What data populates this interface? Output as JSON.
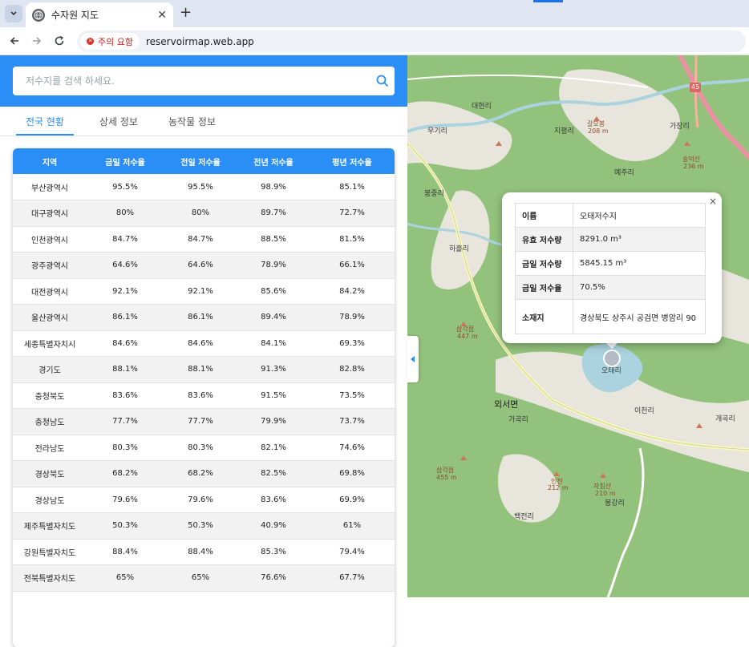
{
  "browser": {
    "tab_title": "수자원 지도",
    "new_tab_label": "+",
    "security_label": "주의 요함",
    "url": "reservoirmap.web.app"
  },
  "search": {
    "placeholder": "저수지를 검색 하세요."
  },
  "tabs": [
    {
      "label": "전국 현황"
    },
    {
      "label": "상세 정보"
    },
    {
      "label": "농작물 정보"
    }
  ],
  "table": {
    "headers": [
      "지역",
      "금일 저수율",
      "전일 저수율",
      "전년 저수율",
      "평년 저수율"
    ],
    "rows": [
      [
        "부산광역시",
        "95.5%",
        "95.5%",
        "98.9%",
        "85.1%"
      ],
      [
        "대구광역시",
        "80%",
        "80%",
        "89.7%",
        "72.7%"
      ],
      [
        "인천광역시",
        "84.7%",
        "84.7%",
        "88.5%",
        "81.5%"
      ],
      [
        "광주광역시",
        "64.6%",
        "64.6%",
        "78.9%",
        "66.1%"
      ],
      [
        "대전광역시",
        "92.1%",
        "92.1%",
        "85.6%",
        "84.2%"
      ],
      [
        "울산광역시",
        "86.1%",
        "86.1%",
        "89.4%",
        "78.9%"
      ],
      [
        "세종특별자치시",
        "84.6%",
        "84.6%",
        "84.1%",
        "69.3%"
      ],
      [
        "경기도",
        "88.1%",
        "88.1%",
        "91.3%",
        "82.8%"
      ],
      [
        "충청북도",
        "83.6%",
        "83.6%",
        "91.5%",
        "73.5%"
      ],
      [
        "충청남도",
        "77.7%",
        "77.7%",
        "79.9%",
        "73.7%"
      ],
      [
        "전라남도",
        "80.3%",
        "80.3%",
        "82.1%",
        "74.6%"
      ],
      [
        "경상북도",
        "68.2%",
        "68.2%",
        "82.5%",
        "69.8%"
      ],
      [
        "경상남도",
        "79.6%",
        "79.6%",
        "83.6%",
        "69.9%"
      ],
      [
        "제주특별자치도",
        "50.3%",
        "50.3%",
        "40.9%",
        "61%"
      ],
      [
        "강원특별자치도",
        "88.4%",
        "88.4%",
        "85.3%",
        "79.4%"
      ],
      [
        "전북특별자치도",
        "65%",
        "65%",
        "76.6%",
        "67.7%"
      ]
    ]
  },
  "map": {
    "labels": [
      {
        "text": "대현리"
      },
      {
        "text": "우기리"
      },
      {
        "text": "지평리"
      },
      {
        "text": "갈모봉"
      },
      {
        "text": "208 m"
      },
      {
        "text": "가장리"
      },
      {
        "text": "송덕산"
      },
      {
        "text": "236 m"
      },
      {
        "text": "예주리"
      },
      {
        "text": "봉중리"
      },
      {
        "text": "하흘리"
      },
      {
        "text": "삼각점"
      },
      {
        "text": "447 m"
      },
      {
        "text": "오태리"
      },
      {
        "text": "외서면"
      },
      {
        "text": "가곡리"
      },
      {
        "text": "이천리"
      },
      {
        "text": "개곡리"
      },
      {
        "text": "삼각점"
      },
      {
        "text": "455 m"
      },
      {
        "text": "인천"
      },
      {
        "text": "212 m"
      },
      {
        "text": "자침산"
      },
      {
        "text": "210 m"
      },
      {
        "text": "봉강리"
      },
      {
        "text": "백전리"
      },
      {
        "text": "45"
      }
    ],
    "popup": {
      "rows": [
        {
          "key": "이름",
          "value": "오태저수지"
        },
        {
          "key": "유효 저수량",
          "value": "8291.0 m³"
        },
        {
          "key": "금일 저수량",
          "value": "5845.15 m³"
        },
        {
          "key": "금일 저수율",
          "value": "70.5%"
        },
        {
          "key": "소재지",
          "value": "경상북도 상주시 공검면 병암리 90"
        }
      ],
      "close_label": "×"
    }
  }
}
